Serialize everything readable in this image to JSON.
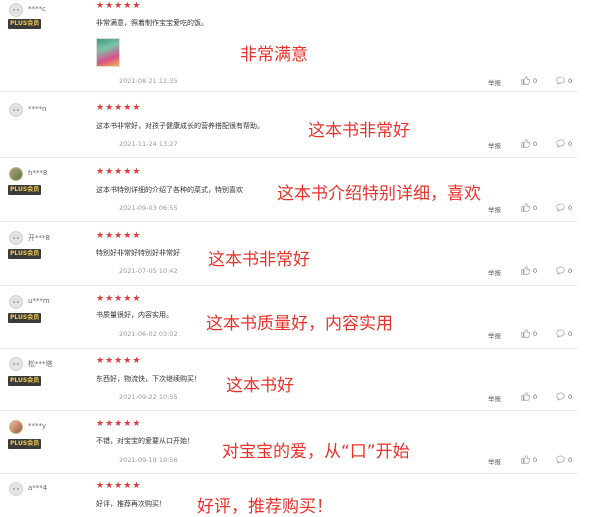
{
  "labels": {
    "plus": "PLUS会员",
    "report": "举报"
  },
  "reviews": [
    {
      "user": "****c",
      "plus": true,
      "text": "非常满意，照着制作宝宝爱吃的饭。",
      "date": "2021-08-21 12:35",
      "likes": "0",
      "replies": "0",
      "annotation": "非常满意",
      "has_image": true
    },
    {
      "user": "****n",
      "plus": false,
      "text": "这本书非常好，对孩子健康成长的营养搭配很有帮助。",
      "date": "2021-11-24 13:27",
      "likes": "0",
      "replies": "0",
      "annotation": "这本书非常好"
    },
    {
      "user": "h***8",
      "plus": true,
      "text": "这本书特别详细的介绍了各种的菜式，特别喜欢",
      "date": "2021-09-03 06:55",
      "likes": "0",
      "replies": "0",
      "annotation": "这本书介绍特别详细，喜欢"
    },
    {
      "user": "开***8",
      "plus": true,
      "text": "特别好非常好特别好非常好",
      "date": "2021-07-05 10:42",
      "likes": "0",
      "replies": "0",
      "annotation": "这本书非常好"
    },
    {
      "user": "u***m",
      "plus": true,
      "text": "书质量很好，内容实用。",
      "date": "2021-06-02 03:02",
      "likes": "0",
      "replies": "0",
      "annotation": "这本书质量好，内容实用"
    },
    {
      "user": "松***塔",
      "plus": true,
      "text": "东西好，物流快，下次继续购买！",
      "date": "2021-09-22 10:55",
      "likes": "0",
      "replies": "0",
      "annotation": "这本书好"
    },
    {
      "user": "****y",
      "plus": true,
      "text": "不错，对宝宝的爱要从口开始！",
      "date": "2021-09-19 19:56",
      "likes": "0",
      "replies": "0",
      "annotation": "对宝宝的爱，从“口”开始"
    },
    {
      "user": "a***4",
      "plus": false,
      "text": "好评，推荐再次购买！",
      "date": "",
      "likes": "",
      "replies": "",
      "annotation": "好评，推荐购买！"
    }
  ]
}
